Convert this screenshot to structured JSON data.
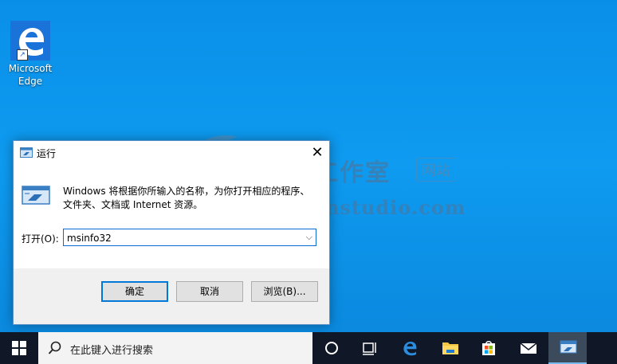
{
  "desktop": {
    "icons": [
      {
        "label_line1": "Microsoft",
        "label_line2": "Edge",
        "icon": "edge-icon"
      }
    ],
    "watermark": {
      "chinese": "腾龙工作室",
      "tag": "网站",
      "english": "Tenlonstudio.com"
    }
  },
  "run_dialog": {
    "title": "运行",
    "description_line1": "Windows 将根据你所输入的名称，为你打开相应的程序、",
    "description_line2": "文件夹、文档或 Internet 资源。",
    "open_label": "打开(O):",
    "open_value": "msinfo32",
    "buttons": {
      "ok": "确定",
      "cancel": "取消",
      "browse": "浏览(B)..."
    },
    "close_glyph": "✕"
  },
  "taskbar": {
    "search_placeholder": "在此键入进行搜索",
    "items": [
      "start-icon",
      "cortana-icon",
      "task-view-icon",
      "edge-icon",
      "file-explorer-icon",
      "store-icon",
      "mail-icon",
      "run-icon"
    ],
    "accent": "#0078d7"
  }
}
